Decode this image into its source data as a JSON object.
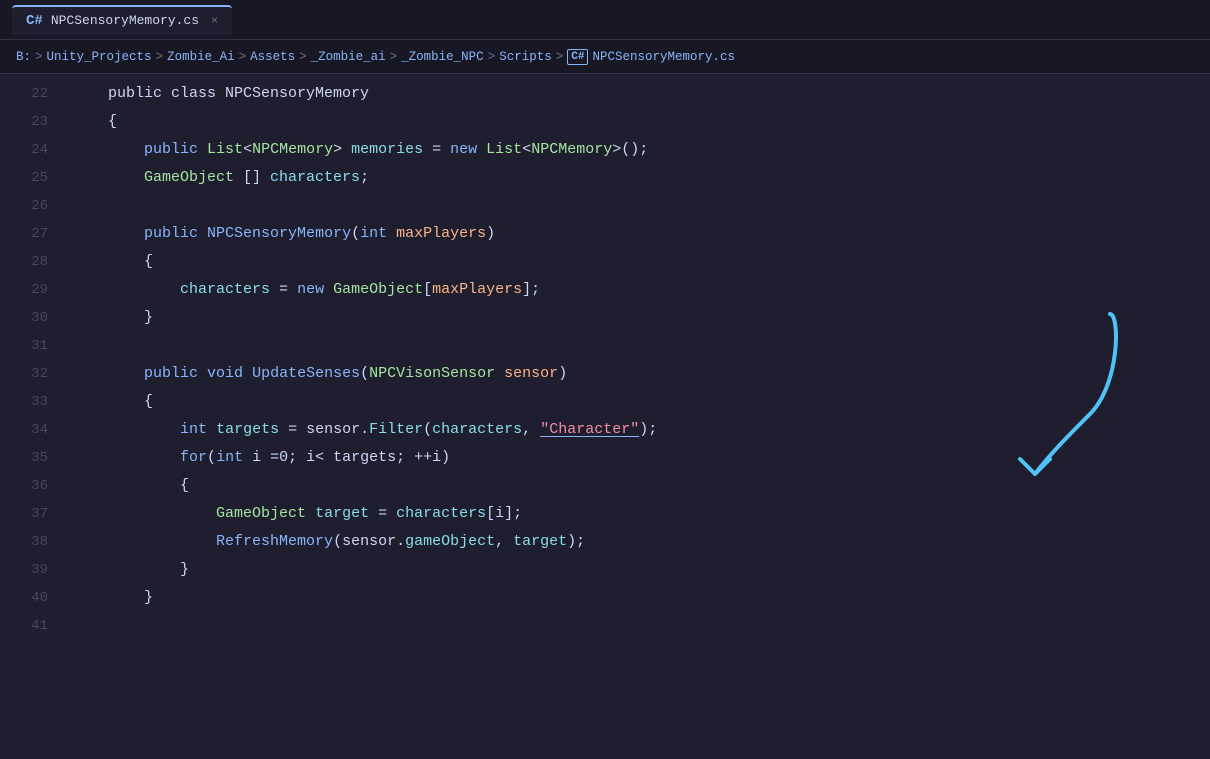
{
  "titleBar": {
    "tabIcon": "C#",
    "tabName": "NPCSensoryMemory.cs",
    "closeLabel": "×"
  },
  "breadcrumb": {
    "prefix": "B:",
    "parts": [
      "Unity_Projects",
      "Zombie_Ai",
      "Assets",
      "_Zombie_ai",
      "_Zombie_NPC",
      "Scripts"
    ],
    "fileIcon": "C#",
    "fileName": "NPCSensoryMemory.cs",
    "separators": [
      ">",
      ">",
      ">",
      ">",
      ">",
      ">",
      ">"
    ]
  },
  "lines": [
    {
      "num": 22,
      "tokens": [
        {
          "t": "    public class NPCSensoryMemory",
          "c": "plain"
        }
      ]
    },
    {
      "num": 23,
      "tokens": [
        {
          "t": "    {",
          "c": "punct"
        }
      ]
    },
    {
      "num": 24,
      "tokens": [
        {
          "t": "        ",
          "c": "plain"
        },
        {
          "t": "public",
          "c": "kw"
        },
        {
          "t": " ",
          "c": "plain"
        },
        {
          "t": "List",
          "c": "type"
        },
        {
          "t": "<",
          "c": "punct"
        },
        {
          "t": "NPCMemory",
          "c": "type"
        },
        {
          "t": "> ",
          "c": "punct"
        },
        {
          "t": "memories",
          "c": "field"
        },
        {
          "t": " = ",
          "c": "plain"
        },
        {
          "t": "new",
          "c": "kw"
        },
        {
          "t": " ",
          "c": "plain"
        },
        {
          "t": "List",
          "c": "type"
        },
        {
          "t": "<",
          "c": "punct"
        },
        {
          "t": "NPCMemory",
          "c": "type"
        },
        {
          "t": ">();",
          "c": "punct"
        }
      ]
    },
    {
      "num": 25,
      "tokens": [
        {
          "t": "        ",
          "c": "plain"
        },
        {
          "t": "GameObject",
          "c": "type"
        },
        {
          "t": " [] ",
          "c": "punct"
        },
        {
          "t": "characters",
          "c": "field"
        },
        {
          "t": ";",
          "c": "punct"
        }
      ]
    },
    {
      "num": 26,
      "tokens": []
    },
    {
      "num": 27,
      "tokens": [
        {
          "t": "        ",
          "c": "plain"
        },
        {
          "t": "public",
          "c": "kw"
        },
        {
          "t": " ",
          "c": "plain"
        },
        {
          "t": "NPCSensoryMemory",
          "c": "method"
        },
        {
          "t": "(",
          "c": "punct"
        },
        {
          "t": "int",
          "c": "kw"
        },
        {
          "t": " ",
          "c": "plain"
        },
        {
          "t": "maxPlayers",
          "c": "param"
        },
        {
          "t": ")",
          "c": "punct"
        }
      ]
    },
    {
      "num": 28,
      "tokens": [
        {
          "t": "        {",
          "c": "punct"
        }
      ]
    },
    {
      "num": 29,
      "tokens": [
        {
          "t": "            ",
          "c": "plain"
        },
        {
          "t": "characters",
          "c": "field"
        },
        {
          "t": " = ",
          "c": "plain"
        },
        {
          "t": "new",
          "c": "kw"
        },
        {
          "t": " ",
          "c": "plain"
        },
        {
          "t": "GameObject",
          "c": "type"
        },
        {
          "t": "[",
          "c": "punct"
        },
        {
          "t": "maxPlayers",
          "c": "param"
        },
        {
          "t": "];",
          "c": "punct"
        }
      ]
    },
    {
      "num": 30,
      "tokens": [
        {
          "t": "        }",
          "c": "punct"
        }
      ]
    },
    {
      "num": 31,
      "tokens": []
    },
    {
      "num": 32,
      "tokens": [
        {
          "t": "        ",
          "c": "plain"
        },
        {
          "t": "public",
          "c": "kw"
        },
        {
          "t": " ",
          "c": "plain"
        },
        {
          "t": "void",
          "c": "kw"
        },
        {
          "t": " ",
          "c": "plain"
        },
        {
          "t": "UpdateSenses",
          "c": "method"
        },
        {
          "t": "(",
          "c": "punct"
        },
        {
          "t": "NPCVisonSensor",
          "c": "type"
        },
        {
          "t": " ",
          "c": "plain"
        },
        {
          "t": "sensor",
          "c": "param"
        },
        {
          "t": ")",
          "c": "punct"
        }
      ]
    },
    {
      "num": 33,
      "tokens": [
        {
          "t": "        {",
          "c": "punct"
        }
      ]
    },
    {
      "num": 34,
      "tokens": [
        {
          "t": "            ",
          "c": "plain"
        },
        {
          "t": "int",
          "c": "kw"
        },
        {
          "t": " ",
          "c": "plain"
        },
        {
          "t": "targets",
          "c": "field"
        },
        {
          "t": " = ",
          "c": "plain"
        },
        {
          "t": "sensor",
          "c": "var"
        },
        {
          "t": ".",
          "c": "punct"
        },
        {
          "t": "Filter",
          "c": "method2"
        },
        {
          "t": "(",
          "c": "punct"
        },
        {
          "t": "characters",
          "c": "field"
        },
        {
          "t": ", ",
          "c": "plain"
        },
        {
          "t": "\"Character\"",
          "c": "str underline-blue"
        },
        {
          "t": ");",
          "c": "punct"
        }
      ]
    },
    {
      "num": 35,
      "tokens": [
        {
          "t": "            ",
          "c": "plain"
        },
        {
          "t": "for",
          "c": "kw"
        },
        {
          "t": "(",
          "c": "punct"
        },
        {
          "t": "int",
          "c": "kw"
        },
        {
          "t": " i =0; i< targets; ++i)",
          "c": "plain"
        }
      ]
    },
    {
      "num": 36,
      "tokens": [
        {
          "t": "            {",
          "c": "punct"
        }
      ]
    },
    {
      "num": 37,
      "tokens": [
        {
          "t": "                ",
          "c": "plain"
        },
        {
          "t": "GameObject",
          "c": "type"
        },
        {
          "t": " ",
          "c": "plain"
        },
        {
          "t": "target",
          "c": "field"
        },
        {
          "t": " = ",
          "c": "plain"
        },
        {
          "t": "characters",
          "c": "field"
        },
        {
          "t": "[i];",
          "c": "punct"
        }
      ]
    },
    {
      "num": 38,
      "tokens": [
        {
          "t": "                ",
          "c": "plain"
        },
        {
          "t": "RefreshMemory",
          "c": "method"
        },
        {
          "t": "(",
          "c": "punct"
        },
        {
          "t": "sensor",
          "c": "var"
        },
        {
          "t": ".",
          "c": "punct"
        },
        {
          "t": "gameObject",
          "c": "field"
        },
        {
          "t": ", ",
          "c": "plain"
        },
        {
          "t": "target",
          "c": "field"
        },
        {
          "t": ");",
          "c": "punct"
        }
      ]
    },
    {
      "num": 39,
      "tokens": [
        {
          "t": "            }",
          "c": "punct"
        }
      ]
    },
    {
      "num": 40,
      "tokens": [
        {
          "t": "        }",
          "c": "punct"
        }
      ]
    },
    {
      "num": 41,
      "tokens": []
    }
  ]
}
